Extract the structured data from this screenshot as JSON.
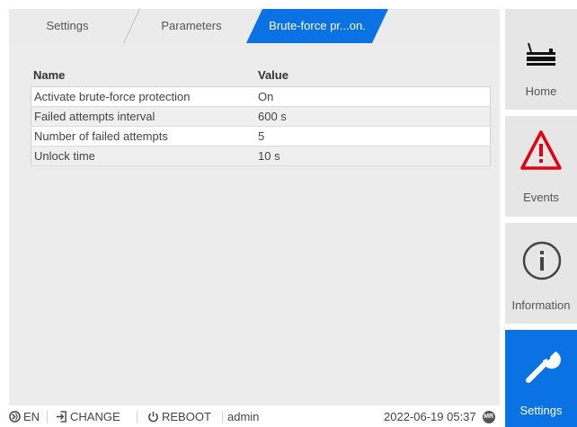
{
  "tabs": [
    {
      "label": "Settings"
    },
    {
      "label": "Parameters"
    },
    {
      "label": "Brute-force pr...on."
    }
  ],
  "table": {
    "headers": [
      "Name",
      "Value"
    ],
    "rows": [
      {
        "name": "Activate brute-force protection",
        "value": "On"
      },
      {
        "name": "Failed attempts interval",
        "value": "600 s"
      },
      {
        "name": "Number of failed attempts",
        "value": "5"
      },
      {
        "name": "Unlock time",
        "value": "10 s"
      }
    ]
  },
  "statusbar": {
    "language": "EN",
    "change": "CHANGE",
    "reboot": "REBOOT",
    "user": "admin",
    "datetime": "2022-06-19 05:37",
    "badge": "MR"
  },
  "sidebar": {
    "items": [
      {
        "label": "Home",
        "icon": "home-device-icon"
      },
      {
        "label": "Events",
        "icon": "warning-triangle-icon"
      },
      {
        "label": "Information",
        "icon": "info-circle-icon"
      },
      {
        "label": "Settings",
        "icon": "wrench-icon",
        "active": true
      }
    ]
  },
  "colors": {
    "accent": "#0a72e3",
    "warning": "#e3000f",
    "panel": "#ececec"
  }
}
